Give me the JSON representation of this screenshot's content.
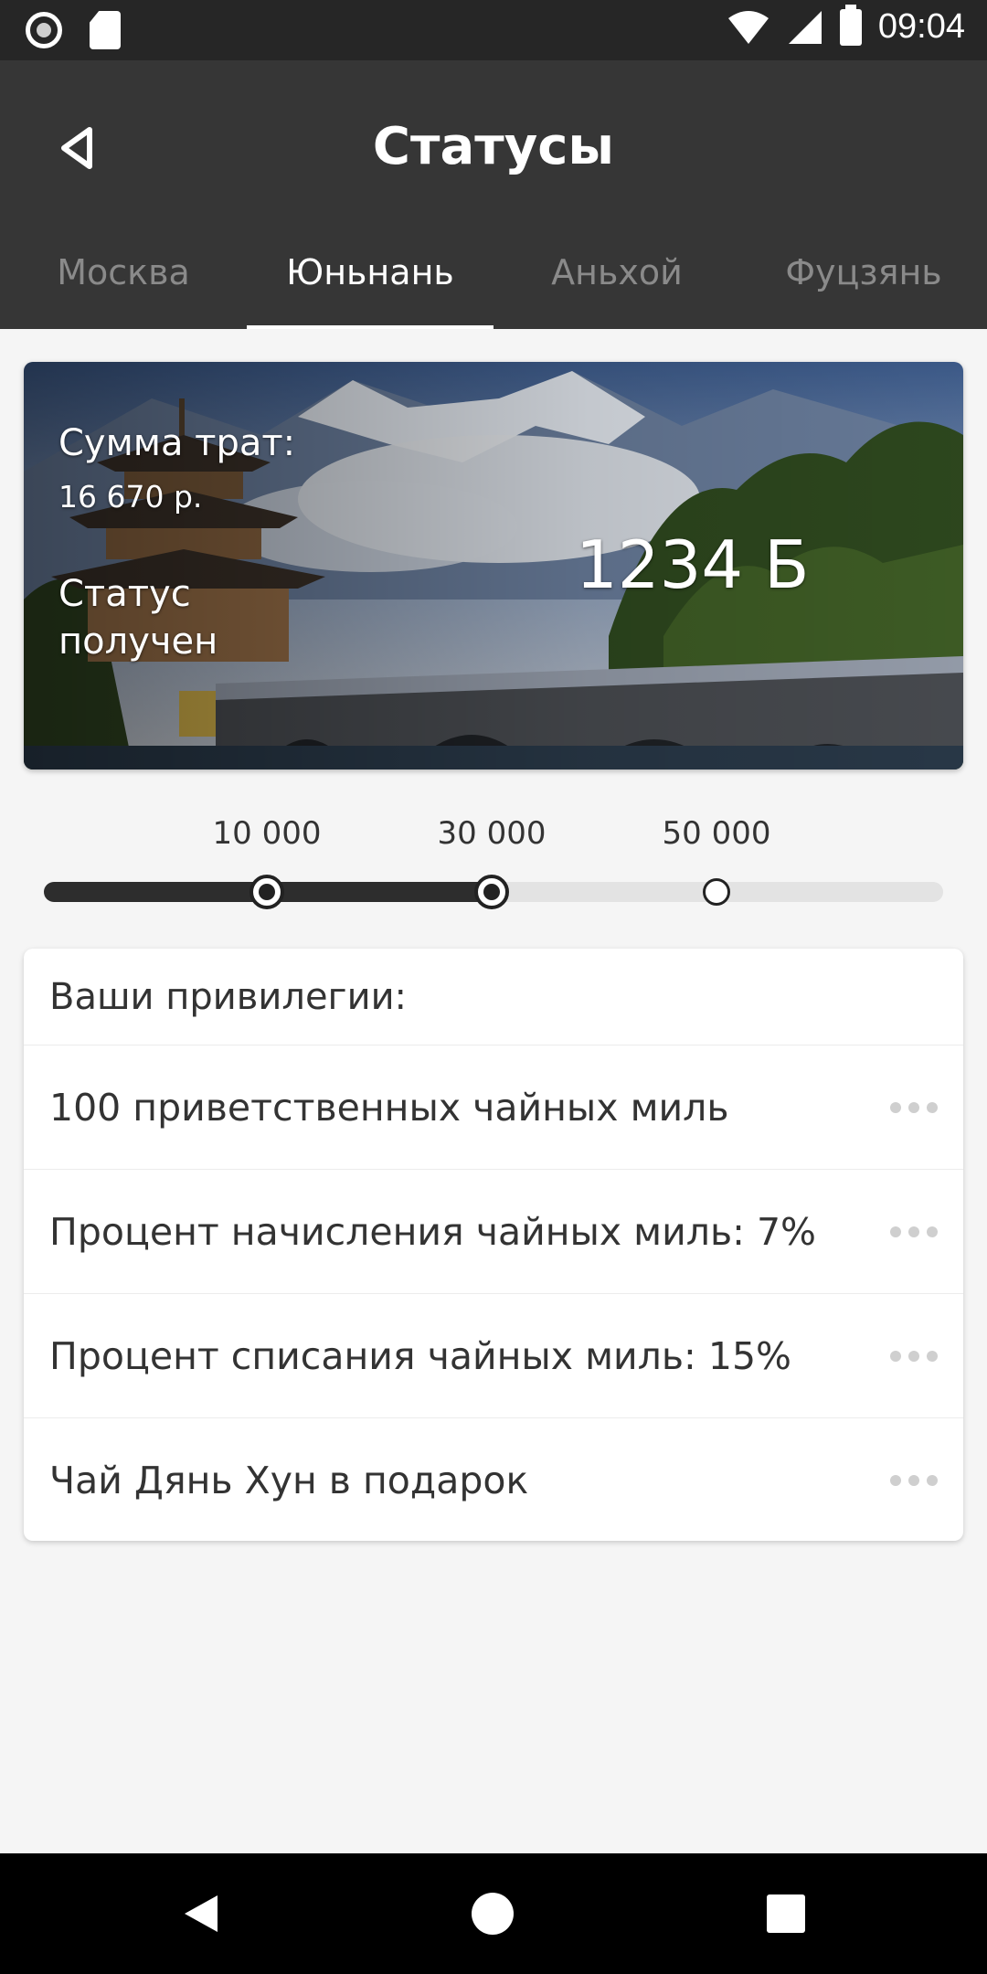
{
  "status_bar": {
    "time": "09:04",
    "icons": [
      "record-icon",
      "sd-card-icon",
      "wifi-icon",
      "signal-icon",
      "battery-icon"
    ]
  },
  "app_bar": {
    "title": "Статусы",
    "back_icon": "back-arrow-icon"
  },
  "tabs": [
    {
      "label": "Москва",
      "active": false
    },
    {
      "label": "Юньнань",
      "active": true
    },
    {
      "label": "Аньхой",
      "active": false
    },
    {
      "label": "Фуцзянь",
      "active": false
    }
  ],
  "hero": {
    "spend_label": "Сумма трат:",
    "spend_value": "16 670 р.",
    "status_label": "Статус получен",
    "points": "1234 Б"
  },
  "progress": {
    "ticks": [
      {
        "label": "10 000",
        "reached": true
      },
      {
        "label": "30 000",
        "reached": true
      },
      {
        "label": "50 000",
        "reached": false
      }
    ],
    "fill_fraction": 0.5
  },
  "privileges": {
    "header": "Ваши привилегии:",
    "items": [
      {
        "text": "100 приветственных чайных миль"
      },
      {
        "text": "Процент начисления чайных миль: 7%"
      },
      {
        "text": "Процент списания чайных миль: 15%"
      },
      {
        "text": "Чай Дянь Хун в подарок"
      }
    ]
  },
  "colors": {
    "app_bar": "#363636",
    "status_bar": "#262626",
    "background": "#f5f5f5",
    "track": "#e3e3e3",
    "track_fill": "#2d2d2d"
  }
}
